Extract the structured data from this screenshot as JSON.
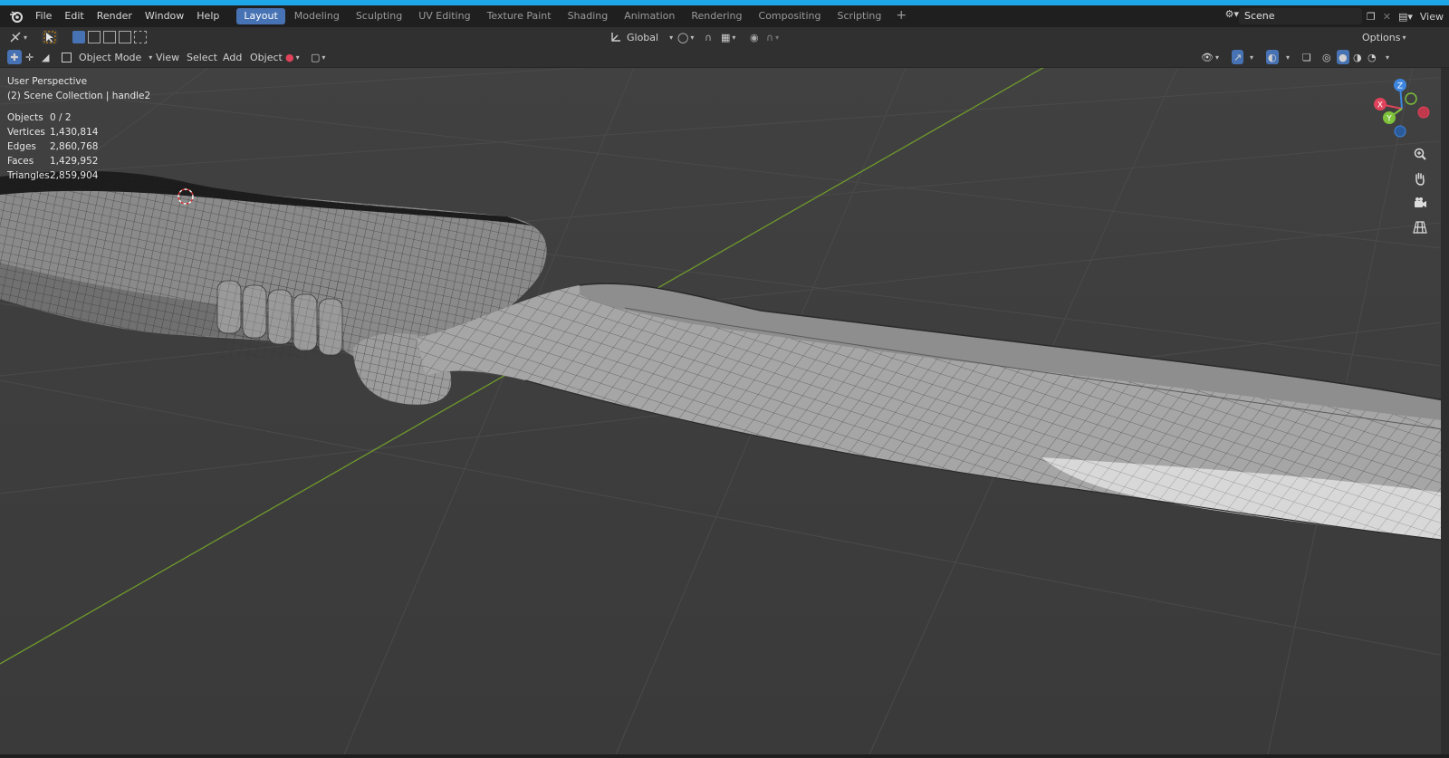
{
  "menubar": {
    "items": [
      "File",
      "Edit",
      "Render",
      "Window",
      "Help"
    ],
    "workspaces": [
      "Layout",
      "Modeling",
      "Sculpting",
      "UV Editing",
      "Texture Paint",
      "Shading",
      "Animation",
      "Rendering",
      "Compositing",
      "Scripting"
    ],
    "active_workspace": "Layout",
    "scene": "Scene",
    "view_label": "View"
  },
  "toolbar1": {
    "transform_orientation": "Global",
    "options_label": "Options"
  },
  "toolbar2": {
    "mode": "Object Mode",
    "menus": [
      "View",
      "Select",
      "Add",
      "Object"
    ]
  },
  "viewport": {
    "perspective": "User Perspective",
    "collection": "(2) Scene Collection | handle2",
    "stats": [
      {
        "label": "Objects",
        "value": "0 / 2"
      },
      {
        "label": "Vertices",
        "value": "1,430,814"
      },
      {
        "label": "Edges",
        "value": "2,860,768"
      },
      {
        "label": "Faces",
        "value": "1,429,952"
      },
      {
        "label": "Triangles",
        "value": "2,859,904"
      }
    ],
    "gizmo": {
      "x": "X",
      "y": "Y",
      "z": "Z"
    }
  },
  "colors": {
    "accent": "#4772b3",
    "x_axis": "#e0435b",
    "y_axis": "#7ec23b",
    "z_axis": "#3d86e0",
    "grid_y_line": "#6f9a2c"
  }
}
